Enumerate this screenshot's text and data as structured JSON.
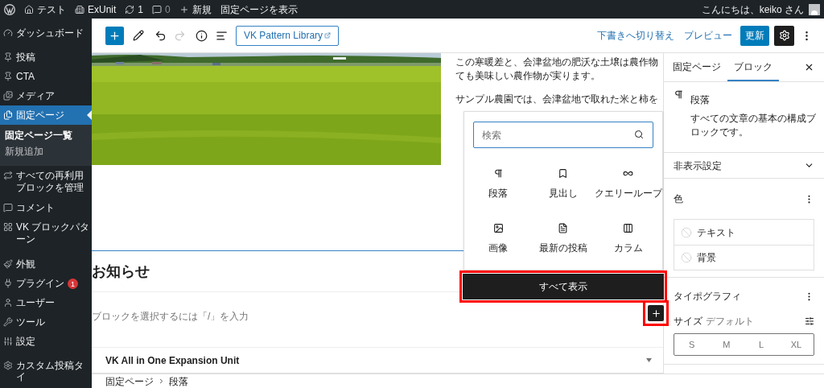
{
  "admin_bar": {
    "items": [
      {
        "kind": "logo"
      },
      {
        "kind": "site",
        "label": "テスト"
      },
      {
        "kind": "exunit",
        "label": "ExUnit"
      },
      {
        "kind": "updates",
        "label": "1"
      },
      {
        "kind": "comments",
        "label": "0"
      },
      {
        "kind": "new",
        "label": "新規"
      },
      {
        "kind": "view",
        "label": "固定ページを表示"
      }
    ],
    "greeting": "こんにちは、keiko さん"
  },
  "sidebar": {
    "groups": [
      [
        {
          "label": "ダッシュボード",
          "selected": false
        }
      ],
      [
        {
          "label": "投稿",
          "selected": false
        },
        {
          "label": "CTA",
          "selected": false
        },
        {
          "label": "メディア",
          "selected": false
        },
        {
          "label": "固定ページ",
          "selected": true,
          "children": [
            {
              "label": "固定ページ一覧",
              "selected": true
            },
            {
              "label": "新規追加",
              "selected": false
            }
          ]
        },
        {
          "label": "すべての再利用ブロックを管理",
          "selected": false
        },
        {
          "label": "コメント",
          "selected": false
        },
        {
          "label": "VK ブロックパターン",
          "selected": false
        }
      ],
      [
        {
          "label": "外観",
          "selected": false
        },
        {
          "label": "プラグイン",
          "selected": false,
          "badge": "1"
        },
        {
          "label": "ユーザー",
          "selected": false
        },
        {
          "label": "ツール",
          "selected": false
        },
        {
          "label": "設定",
          "selected": false
        }
      ],
      [
        {
          "label": "カスタム投稿タイ",
          "selected": false
        }
      ]
    ]
  },
  "toolbar": {
    "redo_disabled": true,
    "pattern_button": "VK Pattern Library",
    "draft_link": "下書きへ切り替え",
    "preview_link": "プレビュー",
    "update_button": "更新",
    "settings_open": true
  },
  "content": {
    "paragraphs": [
      {
        "lines": [
          "この寒暖差と、会津盆地の肥沃な土壌は農作物",
          "ても美味しい農作物が実ります。"
        ]
      },
      {
        "lines": [
          "サンプル農園では、会津盆地で取れた米と柿を"
        ]
      }
    ],
    "heading": "お知らせ",
    "placeholder": "ブロックを選択するには「/」を入力",
    "panel": {
      "title": "VK All in One Expansion Unit",
      "expanded": false
    }
  },
  "inserter": {
    "search_placeholder": "検索",
    "blocks": [
      {
        "label": "段落"
      },
      {
        "label": "見出し"
      },
      {
        "label": "クエリーループ"
      },
      {
        "label": "画像"
      },
      {
        "label": "最新の投稿"
      },
      {
        "label": "カラム"
      }
    ],
    "show_all": {
      "label": "すべて表示",
      "highlighted": true
    },
    "plus_highlighted": true
  },
  "settings": {
    "tabs": [
      {
        "label": "固定ページ",
        "selected": false
      },
      {
        "label": "ブロック",
        "selected": true
      }
    ],
    "block": {
      "title": "段落",
      "description": "すべての文章の基本の構成ブロックです。"
    },
    "sections": [
      {
        "kind": "collapsed",
        "title": "非表示設定",
        "expanded": false
      },
      {
        "kind": "color",
        "title": "色",
        "items": [
          "テキスト",
          "背景"
        ]
      },
      {
        "kind": "typography",
        "title": "タイポグラフィ",
        "size_label": "サイズ",
        "size_value": "デフォルト",
        "sizes": [
          {
            "label": "S",
            "selected": false
          },
          {
            "label": "M",
            "selected": false
          },
          {
            "label": "L",
            "selected": false
          },
          {
            "label": "XL",
            "selected": false
          }
        ]
      }
    ]
  },
  "breadcrumb": [
    "固定ページ",
    "段落"
  ]
}
